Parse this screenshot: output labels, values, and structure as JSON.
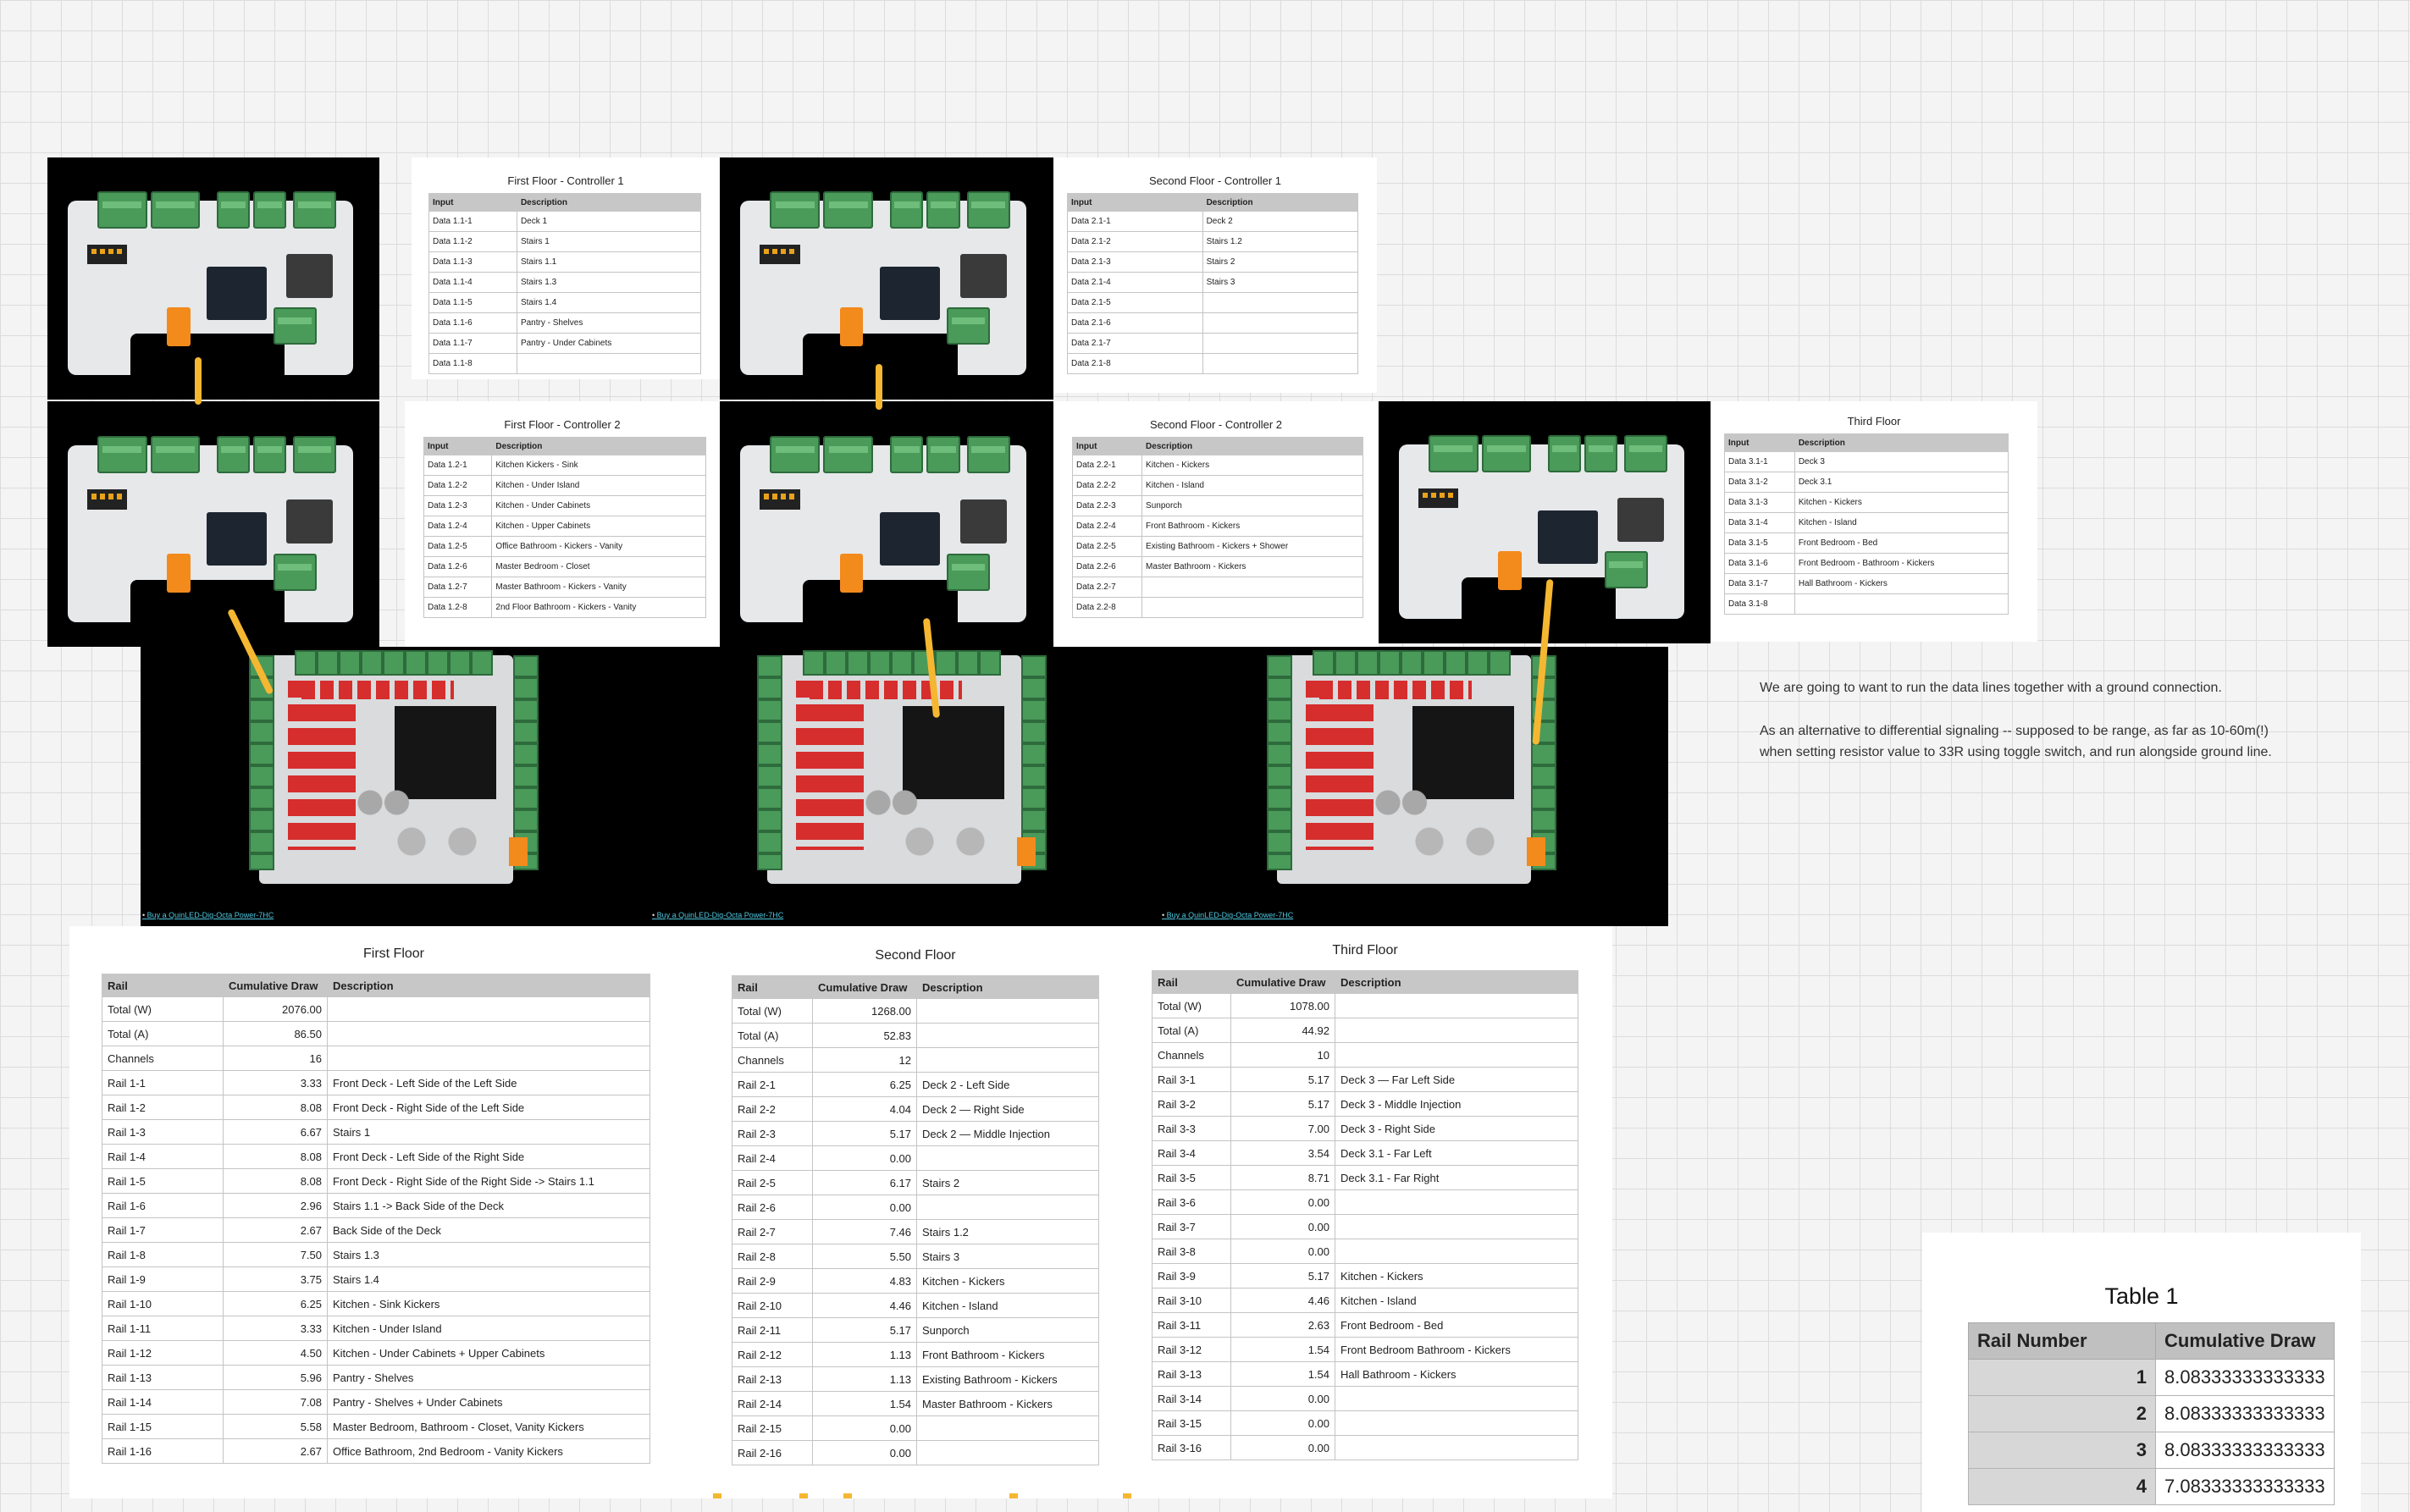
{
  "controller_tables": [
    {
      "title": "First Floor - Controller 1",
      "headers": [
        "Input",
        "Description"
      ],
      "rows": [
        [
          "Data 1.1-1",
          "Deck 1"
        ],
        [
          "Data 1.1-2",
          "Stairs 1"
        ],
        [
          "Data 1.1-3",
          "Stairs 1.1"
        ],
        [
          "Data 1.1-4",
          "Stairs 1.3"
        ],
        [
          "Data 1.1-5",
          "Stairs 1.4"
        ],
        [
          "Data 1.1-6",
          "Pantry - Shelves"
        ],
        [
          "Data 1.1-7",
          "Pantry - Under Cabinets"
        ],
        [
          "Data 1.1-8",
          ""
        ]
      ]
    },
    {
      "title": "First Floor - Controller 2",
      "headers": [
        "Input",
        "Description"
      ],
      "rows": [
        [
          "Data 1.2-1",
          "Kitchen Kickers - Sink"
        ],
        [
          "Data 1.2-2",
          "Kitchen - Under Island"
        ],
        [
          "Data 1.2-3",
          "Kitchen - Under Cabinets"
        ],
        [
          "Data 1.2-4",
          "Kitchen - Upper Cabinets"
        ],
        [
          "Data 1.2-5",
          "Office Bathroom - Kickers  - Vanity"
        ],
        [
          "Data 1.2-6",
          "Master Bedroom - Closet"
        ],
        [
          "Data 1.2-7",
          "Master Bathroom - Kickers - Vanity"
        ],
        [
          "Data 1.2-8",
          "2nd Floor Bathroom - Kickers - Vanity"
        ]
      ]
    },
    {
      "title": "Second Floor - Controller 1",
      "headers": [
        "Input",
        "Description"
      ],
      "rows": [
        [
          "Data 2.1-1",
          "Deck 2"
        ],
        [
          "Data 2.1-2",
          "Stairs 1.2"
        ],
        [
          "Data 2.1-3",
          "Stairs 2"
        ],
        [
          "Data 2.1-4",
          "Stairs 3"
        ],
        [
          "Data 2.1-5",
          ""
        ],
        [
          "Data 2.1-6",
          ""
        ],
        [
          "Data 2.1-7",
          ""
        ],
        [
          "Data 2.1-8",
          ""
        ]
      ]
    },
    {
      "title": "Second Floor - Controller 2",
      "headers": [
        "Input",
        "Description"
      ],
      "rows": [
        [
          "Data 2.2-1",
          "Kitchen - Kickers"
        ],
        [
          "Data 2.2-2",
          "Kitchen - Island"
        ],
        [
          "Data 2.2-3",
          "Sunporch"
        ],
        [
          "Data 2.2-4",
          "Front Bathroom - Kickers"
        ],
        [
          "Data 2.2-5",
          "Existing Bathroom - Kickers + Shower"
        ],
        [
          "Data 2.2-6",
          "Master Bathroom - Kickers"
        ],
        [
          "Data 2.2-7",
          ""
        ],
        [
          "Data 2.2-8",
          ""
        ]
      ]
    },
    {
      "title": "Third Floor",
      "headers": [
        "Input",
        "Description"
      ],
      "rows": [
        [
          "Data 3.1-1",
          "Deck 3"
        ],
        [
          "Data 3.1-2",
          "Deck 3.1"
        ],
        [
          "Data 3.1-3",
          "Kitchen - Kickers"
        ],
        [
          "Data 3.1-4",
          "Kitchen - Island"
        ],
        [
          "Data 3.1-5",
          "Front Bedroom - Bed"
        ],
        [
          "Data 3.1-6",
          "Front Bedroom - Bathroom - Kickers"
        ],
        [
          "Data 3.1-7",
          "Hall Bathroom - Kickers"
        ],
        [
          "Data 3.1-8",
          ""
        ]
      ]
    }
  ],
  "buy_links": [
    "Buy a QuinLED-Dig-Octa Power-7HC",
    "Buy a QuinLED-Dig-Octa Power-7HC",
    "Buy a QuinLED-Dig-Octa Power-7HC"
  ],
  "notes": [
    "We are going to want to run the data lines together with a ground connection.",
    "As an alternative to differential signaling -- supposed to be range, as far as 10-60m(!)",
    "when setting resistor value to 33R using toggle switch, and run alongside ground line."
  ],
  "floor_tables": [
    {
      "title": "First Floor",
      "headers": [
        "Rail",
        "Cumulative Draw",
        "Description"
      ],
      "rows": [
        [
          "Total (W)",
          "2076.00",
          ""
        ],
        [
          "Total (A)",
          "86.50",
          ""
        ],
        [
          "Channels",
          "16",
          ""
        ],
        [
          "Rail 1-1",
          "3.33",
          "Front Deck - Left Side of the Left Side"
        ],
        [
          "Rail 1-2",
          "8.08",
          "Front Deck - Right Side of the Left Side"
        ],
        [
          "Rail 1-3",
          "6.67",
          "Stairs 1"
        ],
        [
          "Rail 1-4",
          "8.08",
          "Front Deck - Left Side of the Right Side"
        ],
        [
          "Rail 1-5",
          "8.08",
          "Front Deck - Right Side of the Right Side -> Stairs 1.1"
        ],
        [
          "Rail 1-6",
          "2.96",
          "Stairs 1.1 -> Back Side of the Deck"
        ],
        [
          "Rail 1-7",
          "2.67",
          "Back Side of the Deck"
        ],
        [
          "Rail 1-8",
          "7.50",
          "Stairs 1.3"
        ],
        [
          "Rail 1-9",
          "3.75",
          "Stairs 1.4"
        ],
        [
          "Rail 1-10",
          "6.25",
          "Kitchen - Sink Kickers"
        ],
        [
          "Rail 1-11",
          "3.33",
          "Kitchen - Under Island"
        ],
        [
          "Rail 1-12",
          "4.50",
          "Kitchen - Under Cabinets + Upper Cabinets"
        ],
        [
          "Rail 1-13",
          "5.96",
          "Pantry - Shelves"
        ],
        [
          "Rail 1-14",
          "7.08",
          "Pantry - Shelves + Under Cabinets"
        ],
        [
          "Rail 1-15",
          "5.58",
          "Master Bedroom, Bathroom - Closet, Vanity Kickers"
        ],
        [
          "Rail 1-16",
          "2.67",
          "Office Bathroom, 2nd Bedroom - Vanity Kickers"
        ]
      ]
    },
    {
      "title": "Second Floor",
      "headers": [
        "Rail",
        "Cumulative Draw",
        "Description"
      ],
      "rows": [
        [
          "Total (W)",
          "1268.00",
          ""
        ],
        [
          "Total (A)",
          "52.83",
          ""
        ],
        [
          "Channels",
          "12",
          ""
        ],
        [
          "Rail 2-1",
          "6.25",
          "Deck 2 - Left Side"
        ],
        [
          "Rail 2-2",
          "4.04",
          "Deck 2 — Right Side"
        ],
        [
          "Rail 2-3",
          "5.17",
          "Deck 2 — Middle Injection"
        ],
        [
          "Rail 2-4",
          "0.00",
          ""
        ],
        [
          "Rail 2-5",
          "6.17",
          "Stairs 2"
        ],
        [
          "Rail 2-6",
          "0.00",
          ""
        ],
        [
          "Rail 2-7",
          "7.46",
          "Stairs 1.2"
        ],
        [
          "Rail 2-8",
          "5.50",
          "Stairs 3"
        ],
        [
          "Rail 2-9",
          "4.83",
          "Kitchen - Kickers"
        ],
        [
          "Rail 2-10",
          "4.46",
          "Kitchen - Island"
        ],
        [
          "Rail 2-11",
          "5.17",
          "Sunporch"
        ],
        [
          "Rail 2-12",
          "1.13",
          "Front Bathroom - Kickers"
        ],
        [
          "Rail 2-13",
          "1.13",
          "Existing Bathroom - Kickers"
        ],
        [
          "Rail 2-14",
          "1.54",
          "Master Bathroom - Kickers"
        ],
        [
          "Rail 2-15",
          "0.00",
          ""
        ],
        [
          "Rail 2-16",
          "0.00",
          ""
        ]
      ]
    },
    {
      "title": "Third Floor",
      "headers": [
        "Rail",
        "Cumulative Draw",
        "Description"
      ],
      "rows": [
        [
          "Total (W)",
          "1078.00",
          ""
        ],
        [
          "Total (A)",
          "44.92",
          ""
        ],
        [
          "Channels",
          "10",
          ""
        ],
        [
          "Rail 3-1",
          "5.17",
          "Deck 3 — Far Left Side"
        ],
        [
          "Rail 3-2",
          "5.17",
          "Deck 3 - Middle Injection"
        ],
        [
          "Rail 3-3",
          "7.00",
          "Deck 3 - Right Side"
        ],
        [
          "Rail 3-4",
          "3.54",
          "Deck 3.1 - Far Left"
        ],
        [
          "Rail 3-5",
          "8.71",
          "Deck 3.1 - Far Right"
        ],
        [
          "Rail 3-6",
          "0.00",
          ""
        ],
        [
          "Rail 3-7",
          "0.00",
          ""
        ],
        [
          "Rail 3-8",
          "0.00",
          ""
        ],
        [
          "Rail 3-9",
          "5.17",
          "Kitchen - Kickers"
        ],
        [
          "Rail 3-10",
          "4.46",
          "Kitchen - Island"
        ],
        [
          "Rail 3-11",
          "2.63",
          "Front Bedroom - Bed"
        ],
        [
          "Rail 3-12",
          "1.54",
          "Front Bedroom Bathroom - Kickers"
        ],
        [
          "Rail 3-13",
          "1.54",
          "Hall Bathroom - Kickers"
        ],
        [
          "Rail 3-14",
          "0.00",
          ""
        ],
        [
          "Rail 3-15",
          "0.00",
          ""
        ],
        [
          "Rail 3-16",
          "0.00",
          ""
        ]
      ]
    }
  ],
  "table1": {
    "title": "Table 1",
    "headers": [
      "Rail Number",
      "Cumulative Draw"
    ],
    "rows": [
      [
        "1",
        "8.08333333333333"
      ],
      [
        "2",
        "8.08333333333333"
      ],
      [
        "3",
        "8.08333333333333"
      ],
      [
        "4",
        "7.08333333333333"
      ]
    ]
  },
  "colors": {
    "canvas": "#f4f4f4",
    "wire": "#f5b731",
    "terminal_green": "#4a9a5a",
    "fuse_red": "#d62d2d",
    "header_gray": "#c7c7c7"
  }
}
